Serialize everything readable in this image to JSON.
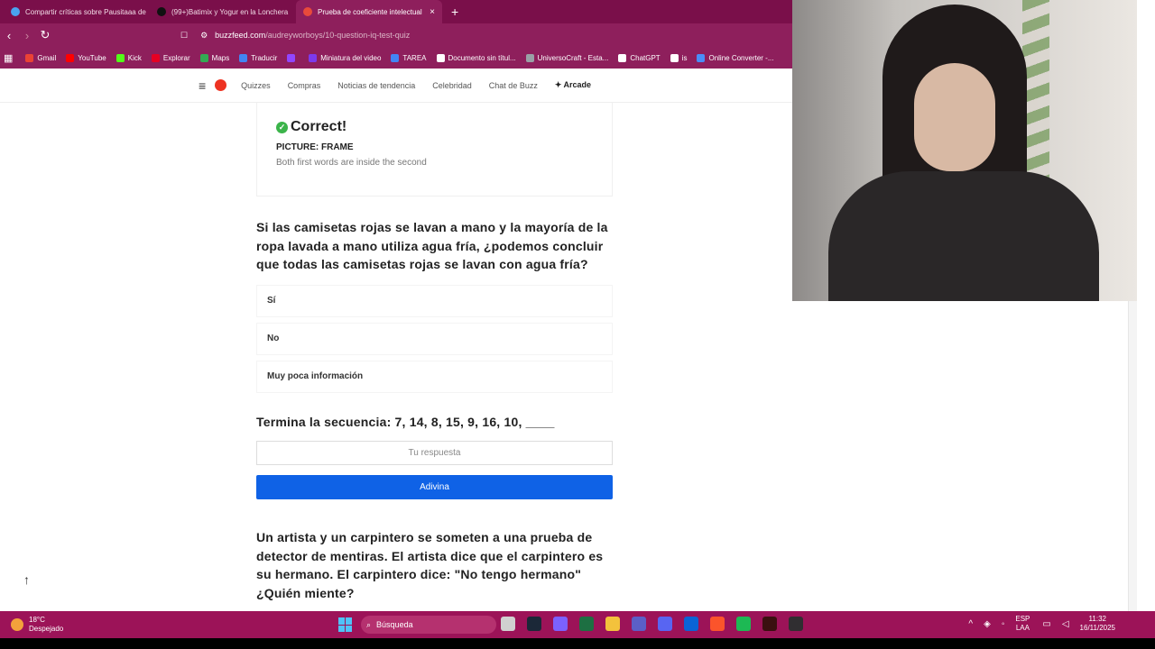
{
  "browser": {
    "tabs": [
      {
        "label": "Compartir críticas sobre Pausitaaa de",
        "color": "#4aa3f0"
      },
      {
        "label": "(99+)Batimix y Yogur en la Lonchera",
        "color": "#111111"
      },
      {
        "label": "Prueba de coeficiente intelectual",
        "color": "#e84a3b"
      }
    ],
    "new_tab": "+",
    "tab_close": "×",
    "url_host": "buzzfeed.com",
    "url_path": "/audreyworboys/10-question-iq-test-quiz",
    "bookmarks": [
      {
        "label": "Gmail",
        "color": "#ea4335"
      },
      {
        "label": "YouTube",
        "color": "#ff0000"
      },
      {
        "label": "Kick",
        "color": "#53fc18"
      },
      {
        "label": "Explorar",
        "color": "#e60023"
      },
      {
        "label": "Maps",
        "color": "#34a853"
      },
      {
        "label": "Traducir",
        "color": "#4285f4"
      },
      {
        "label": "",
        "color": "#9146ff"
      },
      {
        "label": "Miniatura del video",
        "color": "#7c3aed"
      },
      {
        "label": "TAREA",
        "color": "#4285f4"
      },
      {
        "label": "Documento sin títul...",
        "color": "#ffffff"
      },
      {
        "label": "UniversoCraft - Esta...",
        "color": "#9aa0a6"
      },
      {
        "label": "ChatGPT",
        "color": "#ffffff"
      },
      {
        "label": "is",
        "color": "#ffffff"
      },
      {
        "label": "Online Converter -...",
        "color": "#4a8df8"
      }
    ]
  },
  "site_nav": {
    "links": [
      "Quizzes",
      "Compras",
      "Noticias de tendencia",
      "Celebridad",
      "Chat de Buzz",
      "✦ Arcade"
    ]
  },
  "answer_card": {
    "title": "Correct!",
    "check": "✓",
    "picture": "PICTURE: FRAME",
    "explanation": "Both first words are inside the second"
  },
  "question1": {
    "text": "Si las camisetas rojas se lavan a mano y la mayoría de la ropa lavada a mano utiliza agua fría, ¿podemos concluir que todas las camisetas rojas se lavan con agua fría?",
    "options": [
      "Sí",
      "No",
      "Muy poca información"
    ]
  },
  "question2": {
    "text": "Termina la secuencia: 7, 14, 8, 15, 9, 16, 10, ____",
    "placeholder": "Tu respuesta",
    "button": "Adivina"
  },
  "question3": {
    "text": "Un artista y un carpintero se someten a una prueba de detector de mentiras. El artista dice que el carpintero es su hermano. El carpintero dice: \"No tengo hermano\" ¿Quién miente?"
  },
  "taskbar": {
    "temperature": "18°C",
    "weather": "Despejado",
    "search": "Búsqueda",
    "lang1": "ESP",
    "lang2": "LAA",
    "time": "11:32",
    "date": "16/11/2025"
  }
}
